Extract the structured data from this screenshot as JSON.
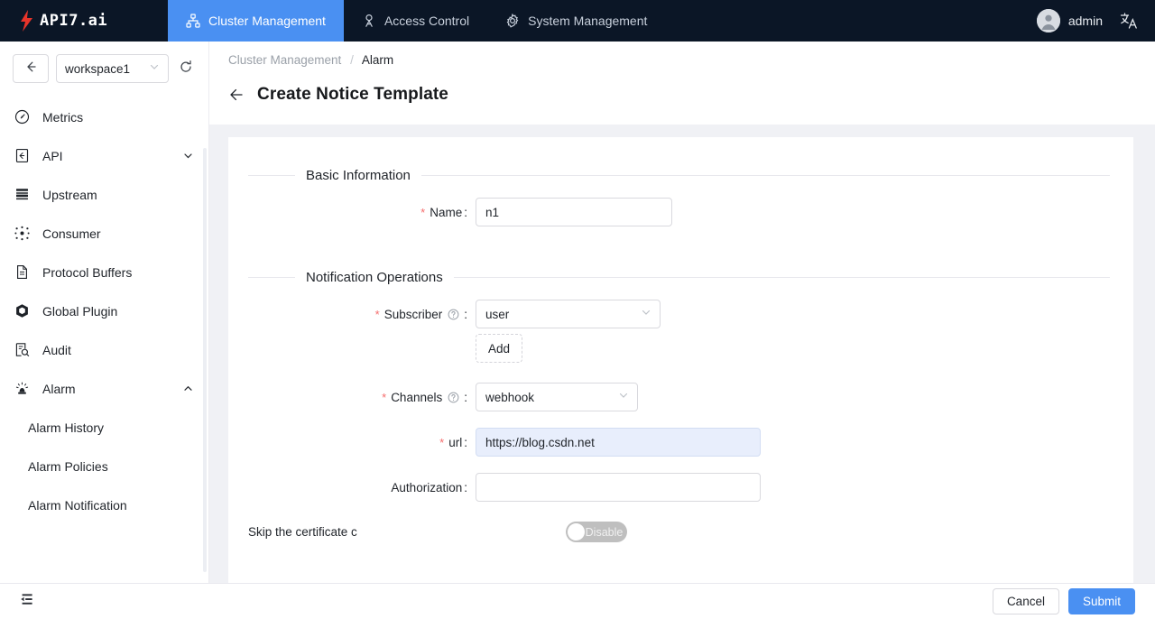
{
  "colors": {
    "topbar_bg": "#0b1626",
    "accent_blue": "#4a90f2",
    "logo_red": "#e8342a",
    "required_red": "#f56c6c",
    "content_bg": "#f0f1f5",
    "autofill_bg": "#e8eefc"
  },
  "topbar": {
    "logo_text": "API7.ai",
    "logo_icon": "lightning-bolt-icon",
    "nav": [
      {
        "label": "Cluster Management",
        "icon": "cluster-icon",
        "active": true
      },
      {
        "label": "Access Control",
        "icon": "access-control-icon",
        "active": false
      },
      {
        "label": "System Management",
        "icon": "gear-icon",
        "active": false
      }
    ],
    "user": {
      "name": "admin",
      "avatar_icon": "user-avatar-icon"
    },
    "language_icon": "language-switch-icon"
  },
  "sidebar": {
    "back_icon": "arrow-left-icon",
    "workspace": {
      "value": "workspace1",
      "caret_icon": "chevron-down-icon"
    },
    "refresh_icon": "refresh-icon",
    "items": [
      {
        "label": "Metrics",
        "icon": "gauge-icon",
        "expandable": false
      },
      {
        "label": "API",
        "icon": "api-doc-icon",
        "expandable": true,
        "caret": "chevron-down-icon"
      },
      {
        "label": "Upstream",
        "icon": "server-stack-icon",
        "expandable": false
      },
      {
        "label": "Consumer",
        "icon": "consumer-network-icon",
        "expandable": false
      },
      {
        "label": "Protocol Buffers",
        "icon": "file-icon",
        "expandable": false
      },
      {
        "label": "Global Plugin",
        "icon": "cube-icon",
        "expandable": false
      },
      {
        "label": "Audit",
        "icon": "audit-search-icon",
        "expandable": false
      },
      {
        "label": "Alarm",
        "icon": "alarm-light-icon",
        "expandable": true,
        "caret": "chevron-up-icon"
      }
    ],
    "submenu": [
      {
        "label": "Alarm History"
      },
      {
        "label": "Alarm Policies"
      },
      {
        "label": "Alarm Notification"
      }
    ]
  },
  "main": {
    "breadcrumb": {
      "parent": "Cluster Management",
      "separator": "/",
      "current": "Alarm"
    },
    "page_title": "Create Notice Template",
    "back_icon": "arrow-left-icon",
    "sections": [
      {
        "title": "Basic Information"
      },
      {
        "title": "Notification Operations"
      }
    ],
    "fields": {
      "name": {
        "label": "Name",
        "suffix": ":",
        "required": true,
        "value": "n1"
      },
      "subscriber": {
        "label": "Subscriber",
        "suffix": ":",
        "required": true,
        "help_icon": "question-circle-icon",
        "value": "user",
        "caret_icon": "chevron-down-icon"
      },
      "add_button": {
        "label": "Add"
      },
      "channels": {
        "label": "Channels",
        "suffix": ":",
        "required": true,
        "help_icon": "question-circle-icon",
        "value": "webhook",
        "caret_icon": "chevron-down-icon"
      },
      "url": {
        "label": "url",
        "suffix": ":",
        "required": true,
        "value": "https://blog.csdn.net",
        "autofilled": true
      },
      "authorization": {
        "label": "Authorization",
        "suffix": ":",
        "required": false,
        "value": ""
      },
      "skip_certificate": {
        "label": "Skip the certificate c",
        "toggle_state_label": "Disable",
        "enabled": false
      }
    }
  },
  "footer": {
    "collapse_icon": "sidebar-collapse-icon",
    "cancel_label": "Cancel",
    "submit_label": "Submit"
  }
}
